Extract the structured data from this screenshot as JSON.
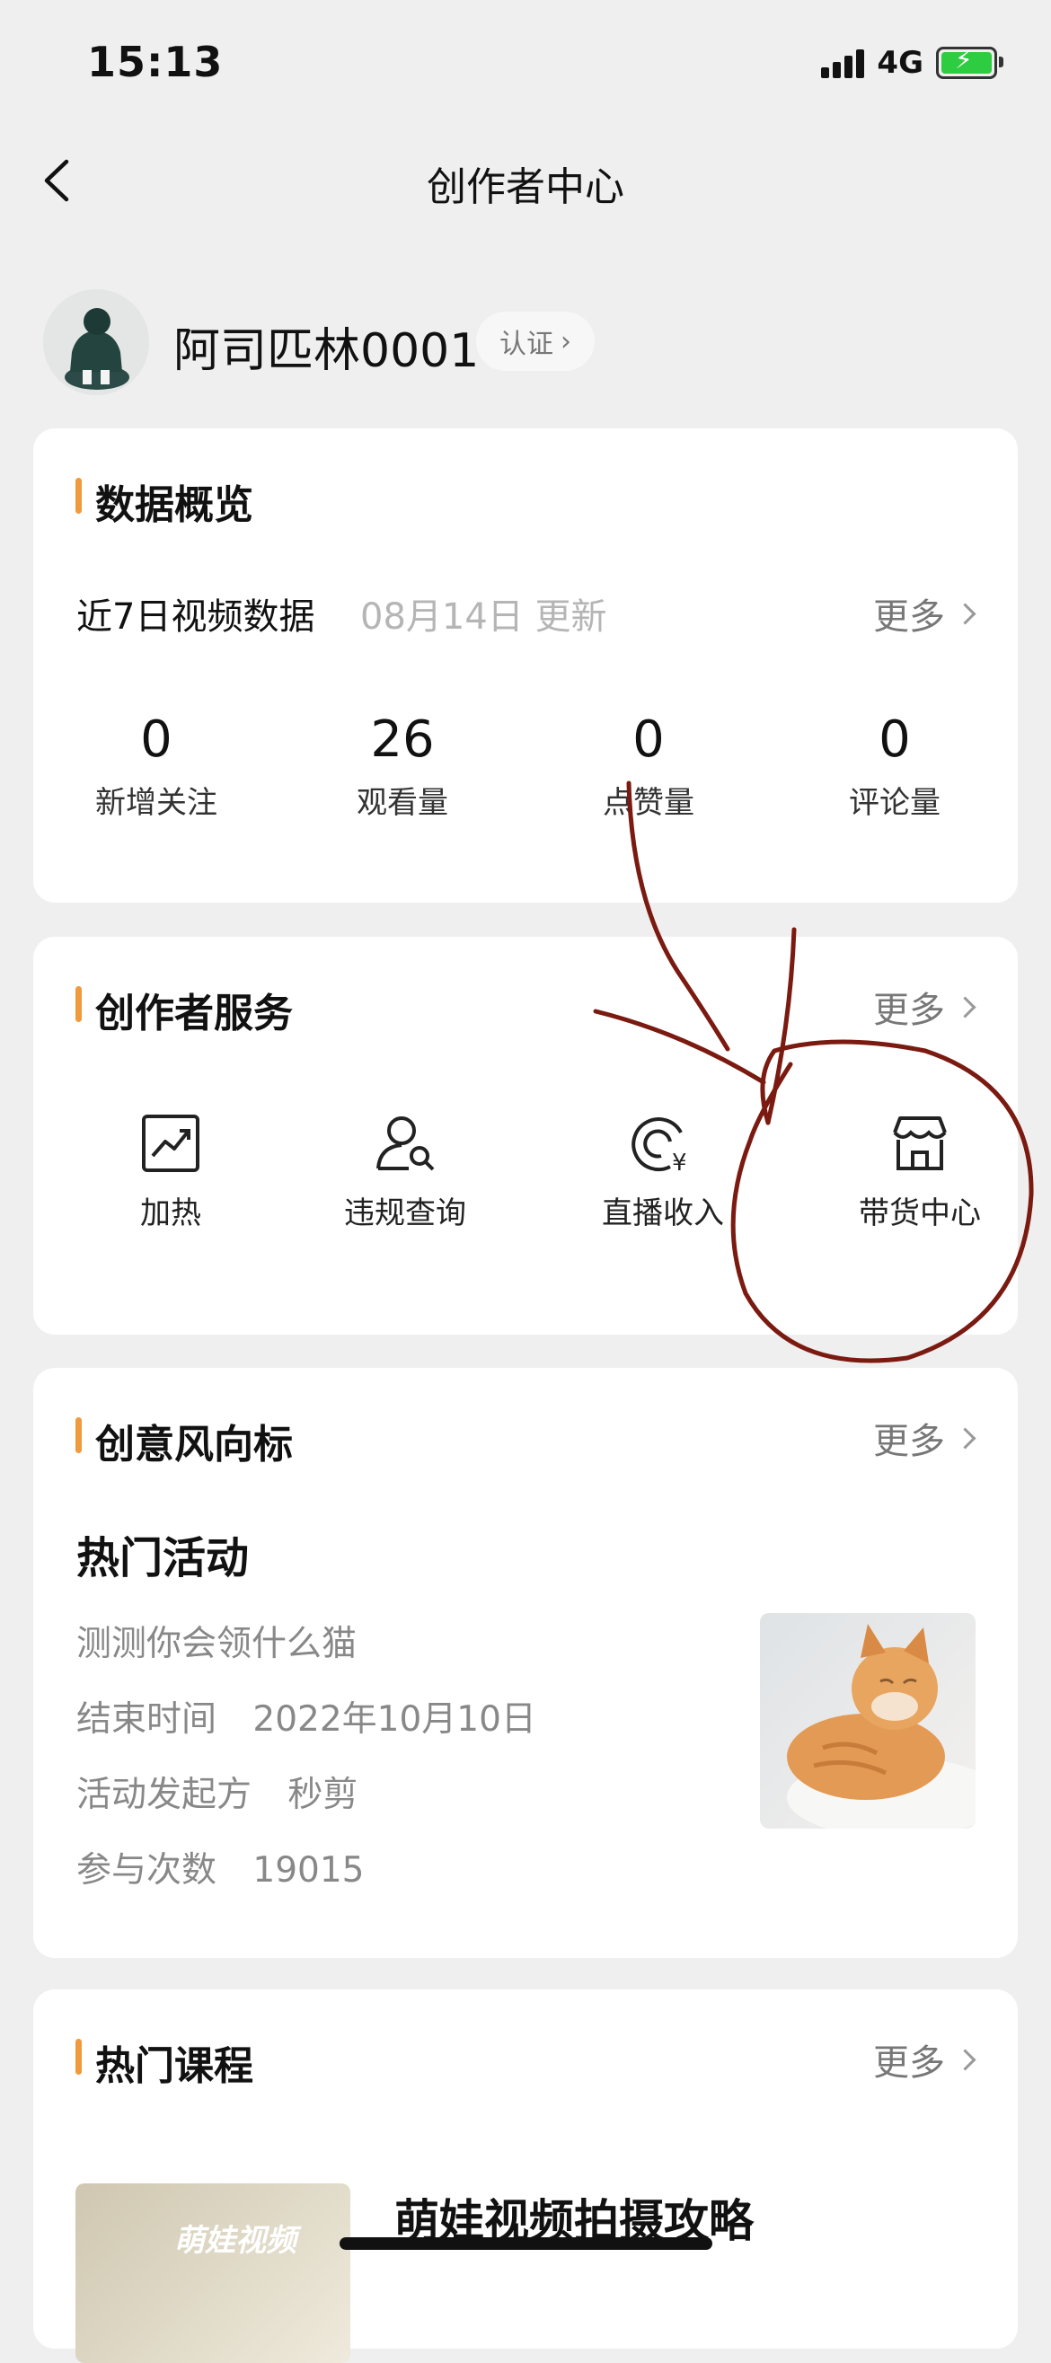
{
  "status_bar": {
    "time": "15:13",
    "network": "4G"
  },
  "nav": {
    "title": "创作者中心"
  },
  "profile": {
    "username": "阿司匹林0001",
    "verify_label": "认证"
  },
  "data_overview": {
    "title": "数据概览",
    "subtitle": "近7日视频数据",
    "updated": "08月14日 更新",
    "more_label": "更多",
    "stats": [
      {
        "value": "0",
        "label": "新增关注"
      },
      {
        "value": "26",
        "label": "观看量"
      },
      {
        "value": "0",
        "label": "点赞量"
      },
      {
        "value": "0",
        "label": "评论量"
      }
    ]
  },
  "creator_services": {
    "title": "创作者服务",
    "more_label": "更多",
    "items": [
      {
        "label": "加热",
        "icon": "trend-chart-icon"
      },
      {
        "label": "违规查询",
        "icon": "user-search-icon"
      },
      {
        "label": "直播收入",
        "icon": "yuan-coin-icon"
      },
      {
        "label": "带货中心",
        "icon": "store-icon"
      }
    ]
  },
  "trends": {
    "title": "创意风向标",
    "more_label": "更多",
    "activity_heading": "热门活动",
    "activity_name": "测测你会领什么猫",
    "end_label": "结束时间",
    "end_value": "2022年10月10日",
    "organizer_label": "活动发起方",
    "organizer_value": "秒剪",
    "participation_label": "参与次数",
    "participation_value": "19015"
  },
  "courses": {
    "title": "热门课程",
    "more_label": "更多",
    "course_title": "萌娃视频拍摄攻略",
    "thumb_text": "萌娃视频"
  },
  "colors": {
    "accent": "#f09a3e",
    "annotation": "#7a1a10"
  }
}
